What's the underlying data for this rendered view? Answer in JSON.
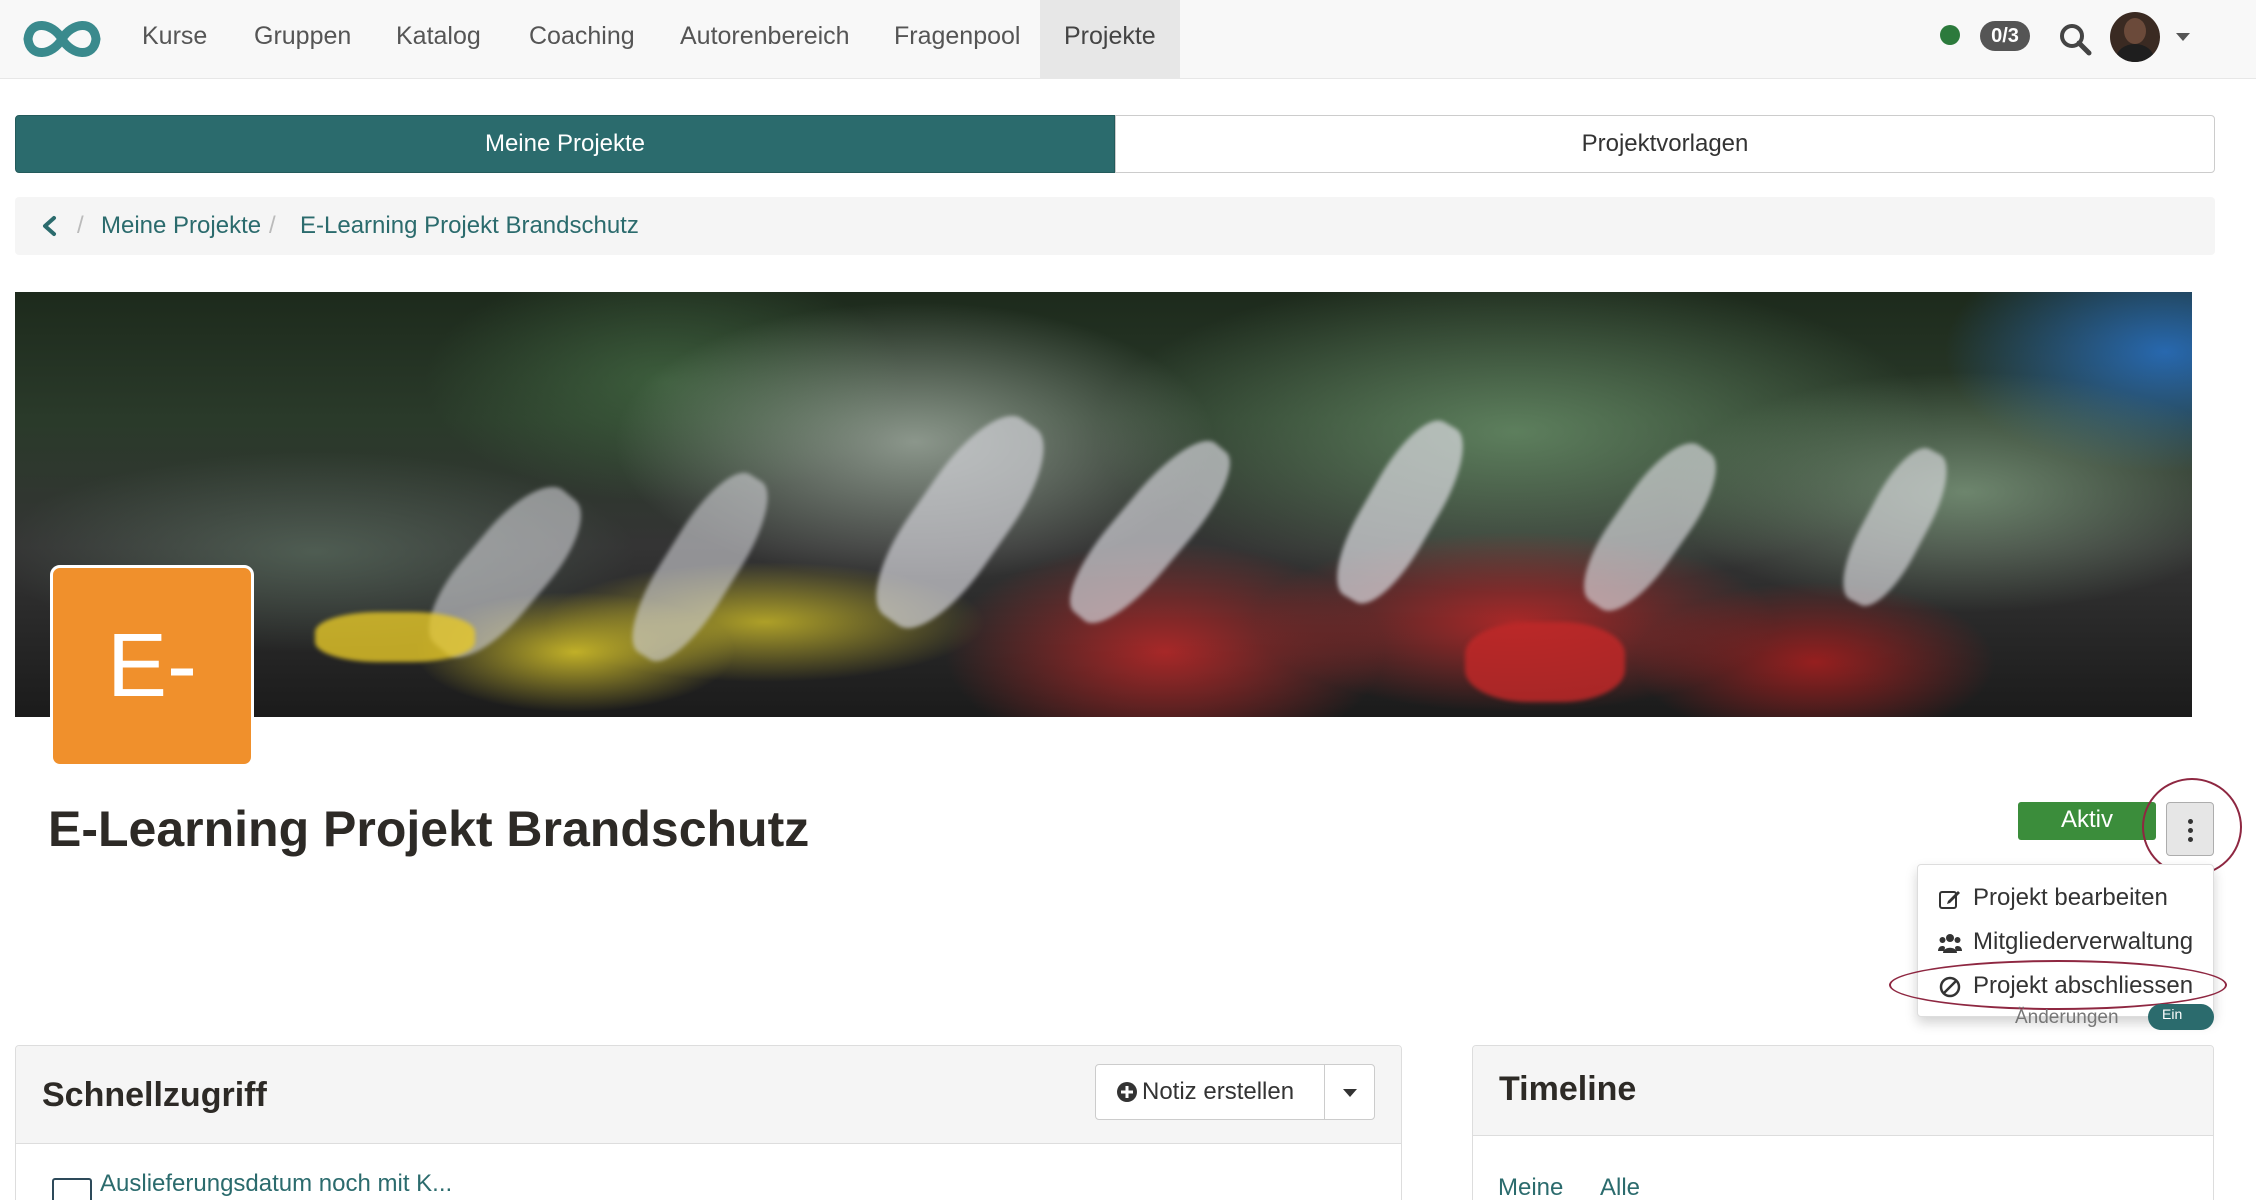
{
  "navbar": {
    "items": [
      {
        "label": "Kurse"
      },
      {
        "label": "Gruppen"
      },
      {
        "label": "Katalog"
      },
      {
        "label": "Coaching"
      },
      {
        "label": "Autorenbereich"
      },
      {
        "label": "Fragenpool"
      },
      {
        "label": "Projekte"
      }
    ],
    "active_index": 6,
    "badge": "0/3",
    "status_color": "#2c7a3c"
  },
  "tabs": {
    "left": "Meine Projekte",
    "right": "Projektvorlagen"
  },
  "breadcrumb": {
    "items": [
      "Meine Projekte",
      "E-Learning Projekt Brandschutz"
    ],
    "separator": "/"
  },
  "project": {
    "initials": "E-",
    "title": "E-Learning Projekt Brandschutz",
    "status": "Aktiv",
    "tile_color": "#f0902c"
  },
  "menu": {
    "items": [
      {
        "label": "Projekt bearbeiten",
        "icon": "edit-icon"
      },
      {
        "label": "Mitgliederverwaltung",
        "icon": "users-icon"
      },
      {
        "label": "Projekt abschliessen",
        "icon": "ban-icon"
      }
    ]
  },
  "changes": {
    "label": "Änderungen",
    "toggle": "Ein"
  },
  "quick_access": {
    "title": "Schnellzugriff",
    "create_note": "Notiz erstellen",
    "first_item": "Auslieferungsdatum noch mit K..."
  },
  "timeline": {
    "title": "Timeline",
    "tabs": [
      "Meine",
      "Alle"
    ]
  },
  "colors": {
    "primary": "#2b6b6d",
    "success": "#3b8d3b",
    "highlight": "#8e2741"
  }
}
